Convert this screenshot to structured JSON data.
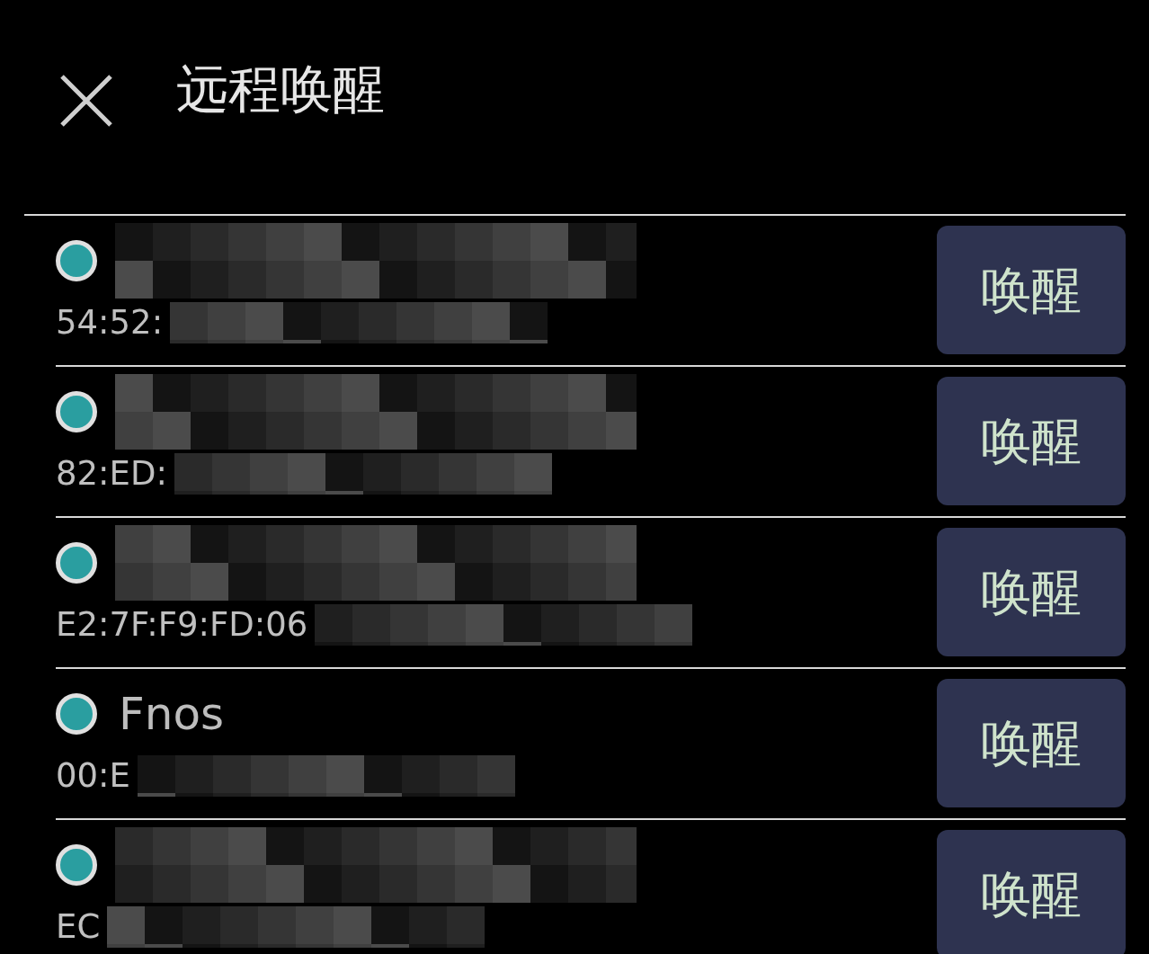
{
  "header": {
    "title": "远程唤醒"
  },
  "devices": [
    {
      "name_redacted": true,
      "mac": "54:52:",
      "mac_redacted": true,
      "online": true,
      "button": "唤醒"
    },
    {
      "name_redacted": true,
      "mac": "82:ED:",
      "mac_redacted": true,
      "online": true,
      "button": "唤醒"
    },
    {
      "name_redacted": true,
      "mac": "E2:7F:F9:FD:06",
      "mac_redacted": true,
      "online": true,
      "button": "唤醒"
    },
    {
      "name": "Fnos",
      "name_redacted": false,
      "mac": "00:E",
      "mac_redacted": true,
      "online": true,
      "button": "唤醒"
    },
    {
      "name_redacted": true,
      "mac": "EC",
      "mac_redacted": true,
      "online": true,
      "button": "唤醒"
    }
  ]
}
